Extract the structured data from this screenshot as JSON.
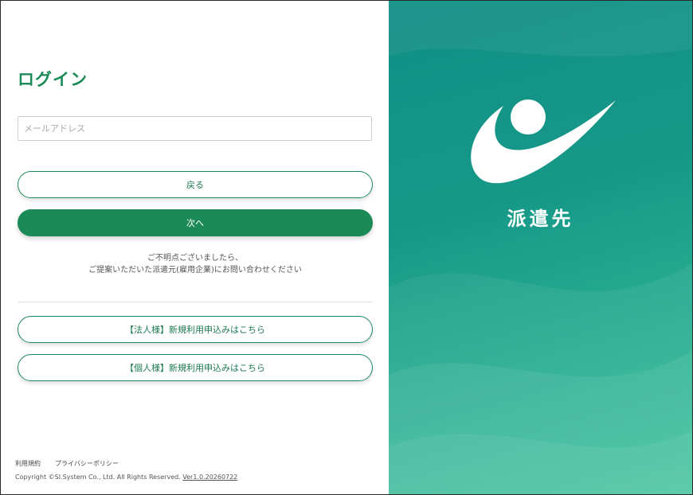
{
  "login": {
    "title": "ログイン",
    "email_placeholder": "メールアドレス",
    "back_label": "戻る",
    "next_label": "次へ",
    "notice_line1": "ご不明点ございましたら、",
    "notice_line2": "ご提案いただいた派遣元(雇用企業)にお問い合わせください",
    "corporate_signup_label": "【法人様】新規利用申込みはこちら",
    "individual_signup_label": "【個人様】新規利用申込みはこちら"
  },
  "footer": {
    "terms_label": "利用規約",
    "privacy_label": "プライバシーポリシー",
    "copyright": "Copyright ©SI.System Co., Ltd. All Rights Reserved. ",
    "version": "Ver1.0.20260722"
  },
  "brand": {
    "name": "派遣先",
    "logo_icon": "person-swoosh-logo-icon"
  },
  "colors": {
    "accent": "#1b8a57",
    "panel_top": "#118f86",
    "panel_bottom": "#3cc198"
  }
}
